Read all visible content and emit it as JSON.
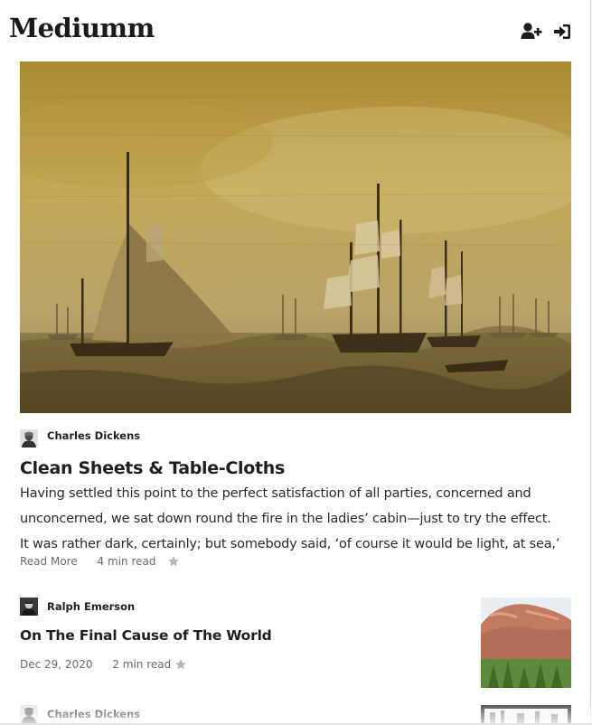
{
  "app": {
    "logo": "Mediumm"
  },
  "header": {
    "icons": [
      {
        "name": "add-user-icon"
      },
      {
        "name": "sign-in-icon"
      }
    ]
  },
  "featured": {
    "image_subject": "sailing-ships-painting",
    "author": "Charles Dickens",
    "title": "Clean Sheets & Table-Cloths",
    "excerpt_lines": [
      "Having settled this point to the perfect satisfaction of all parties, concerned and",
      "unconcerned, we sat down round the fire in the ladies’ cabin—just to try the effect.",
      "It was rather dark, certainly; but somebody said, ‘of course it would be light, at sea,’"
    ],
    "read_more": "Read More",
    "read_time": "4 min read"
  },
  "articles": [
    {
      "author": "Ralph Emerson",
      "title": "On The Final Cause of The World",
      "date": "Dec 29, 2020",
      "read_time": "2 min read",
      "thumb_subject": "red-cliff-with-trees"
    },
    {
      "author": "Charles Dickens",
      "title": "",
      "date": "",
      "read_time": "",
      "thumb_subject": "black-and-white-photo"
    }
  ],
  "colors": {
    "text": "#222222",
    "muted": "#6b6b6b",
    "star": "#b5b5b5",
    "hero_tone": "#a88a35"
  }
}
